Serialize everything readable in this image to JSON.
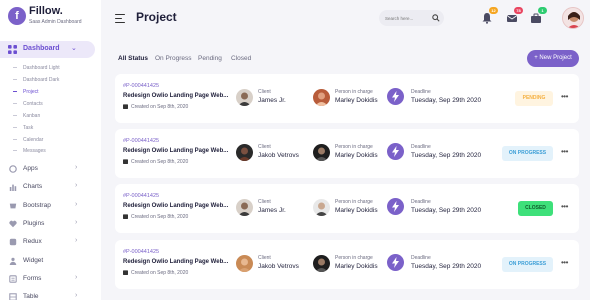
{
  "app": {
    "logo_letter": "f",
    "name": "Fillow.",
    "subtitle": "Saas Admin Dashboard"
  },
  "sidebar": {
    "active": {
      "label": "Dashboard",
      "icon": "dashboard-icon"
    },
    "sub_items": [
      "Dashboard Light",
      "Dashboard Dark",
      "Project",
      "Contacts",
      "Kanban",
      "Task",
      "Calendar",
      "Messages"
    ],
    "active_sub": "Project",
    "items": [
      {
        "label": "Apps",
        "icon": "apps-icon"
      },
      {
        "label": "Charts",
        "icon": "chart-icon"
      },
      {
        "label": "Bootstrap",
        "icon": "bootstrap-icon"
      },
      {
        "label": "Plugins",
        "icon": "heart-icon"
      },
      {
        "label": "Redux",
        "icon": "redux-icon"
      },
      {
        "label": "Widget",
        "icon": "widget-icon"
      },
      {
        "label": "Forms",
        "icon": "forms-icon"
      },
      {
        "label": "Table",
        "icon": "table-icon"
      }
    ]
  },
  "header": {
    "title": "Project",
    "search_placeholder": "Search here...",
    "notifications": {
      "count": "12",
      "color": "#f5a623"
    },
    "messages": {
      "count": "78",
      "color": "#e94560"
    },
    "inbox": {
      "count": "1",
      "color": "#2ecc71"
    }
  },
  "filters": [
    "All Status",
    "On Progress",
    "Pending",
    "Closed"
  ],
  "active_filter": "All Status",
  "new_project_label": "+ New Project",
  "cards": [
    {
      "id": "#P-000441425",
      "name": "Redesign Owlio Landing Page Web...",
      "created": "Created on Sep 8th, 2020",
      "client_label": "Client",
      "client": "James Jr.",
      "person_label": "Person in charge",
      "person": "Marley Dokidis",
      "deadline_label": "Deadline",
      "deadline": "Tuesday, Sep 29th 2020",
      "status": "PENDING",
      "status_color": "#f5b041",
      "status_bg": "#fff4e0"
    },
    {
      "id": "#P-000441425",
      "name": "Redesign Owlio Landing Page Web...",
      "created": "Created on Sep 8th, 2020",
      "client_label": "Client",
      "client": "Jakob Vetrovs",
      "person_label": "Person in charge",
      "person": "Marley Dokidis",
      "deadline_label": "Deadline",
      "deadline": "Tuesday, Sep 29th 2020",
      "status": "ON PROGRESS",
      "status_color": "#3b9ed6",
      "status_bg": "#e3f2fb"
    },
    {
      "id": "#P-000441425",
      "name": "Redesign Owlio Landing Page Web...",
      "created": "Created on Sep 8th, 2020",
      "client_label": "Client",
      "client": "James Jr.",
      "person_label": "Person in charge",
      "person": "Marley Dokidis",
      "deadline_label": "Deadline",
      "deadline": "Tuesday, Sep 29th 2020",
      "status": "CLOSED",
      "status_color": "#1a7f3f",
      "status_bg": "#3ee07a"
    },
    {
      "id": "#P-000441425",
      "name": "Redesign Owlio Landing Page Web...",
      "created": "Created on Sep 8th, 2020",
      "client_label": "Client",
      "client": "Jakob Vetrovs",
      "person_label": "Person in charge",
      "person": "Marley Dokidis",
      "deadline_label": "Deadline",
      "deadline": "Tuesday, Sep 29th 2020",
      "status": "ON PROGRESS",
      "status_color": "#3b9ed6",
      "status_bg": "#e3f2fb"
    }
  ]
}
